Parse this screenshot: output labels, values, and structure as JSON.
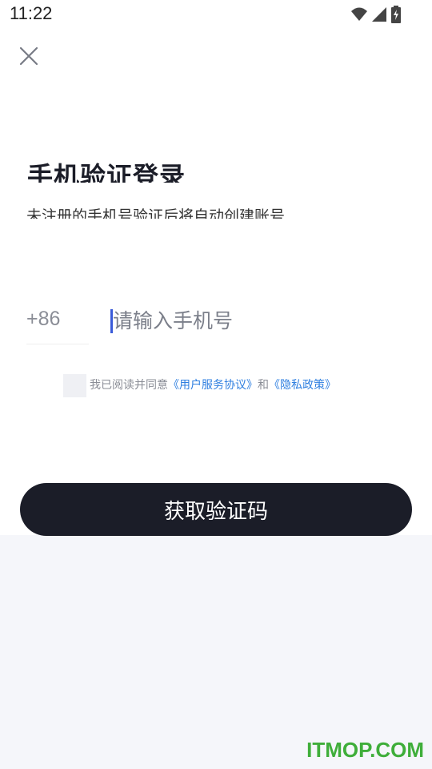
{
  "status_bar": {
    "time": "11:22",
    "icons": [
      "wifi-icon",
      "signal-icon",
      "battery-charging-icon"
    ]
  },
  "header": {
    "close_icon": "close-icon"
  },
  "login": {
    "title": "手机验证登录",
    "subtitle": "未注册的手机号验证后将自动创建账号"
  },
  "phone": {
    "country_code": "+86",
    "placeholder": "请输入手机号",
    "value": ""
  },
  "agreement": {
    "checked": false,
    "prefix": "我已阅读并同意",
    "terms_link": "《用户服务协议》",
    "conjunction": "和",
    "privacy_link": "《隐私政策》"
  },
  "actions": {
    "submit_label": "获取验证码"
  },
  "watermark": {
    "text": "ITMOP.COM"
  },
  "colors": {
    "primary_button": "#1b1d28",
    "link": "#2f7fe0",
    "caret": "#3a5bd9",
    "watermark": "#3fae3a"
  }
}
